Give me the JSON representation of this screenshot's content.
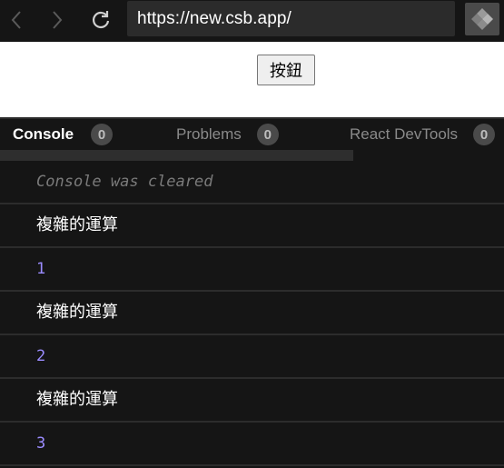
{
  "browser": {
    "url": "https://new.csb.app/",
    "icons": [
      "back-icon",
      "forward-icon",
      "reload-icon",
      "codesandbox-logo-icon"
    ]
  },
  "preview": {
    "button_label": "按鈕"
  },
  "devtools": {
    "tabs": [
      {
        "label": "Console",
        "count": "0",
        "active": true
      },
      {
        "label": "Problems",
        "count": "0",
        "active": false
      },
      {
        "label": "React DevTools",
        "count": "0",
        "active": false
      }
    ]
  },
  "console": {
    "rows": [
      {
        "kind": "cleared",
        "text": "Console was cleared"
      },
      {
        "kind": "text",
        "text": "複雜的運算"
      },
      {
        "kind": "num",
        "text": "1"
      },
      {
        "kind": "text",
        "text": "複雜的運算"
      },
      {
        "kind": "num",
        "text": "2"
      },
      {
        "kind": "text",
        "text": "複雜的運算"
      },
      {
        "kind": "num",
        "text": "3"
      }
    ]
  },
  "colors": {
    "background": "#151515",
    "log_number": "#9b8cff",
    "badge": "#4a4a4a"
  }
}
